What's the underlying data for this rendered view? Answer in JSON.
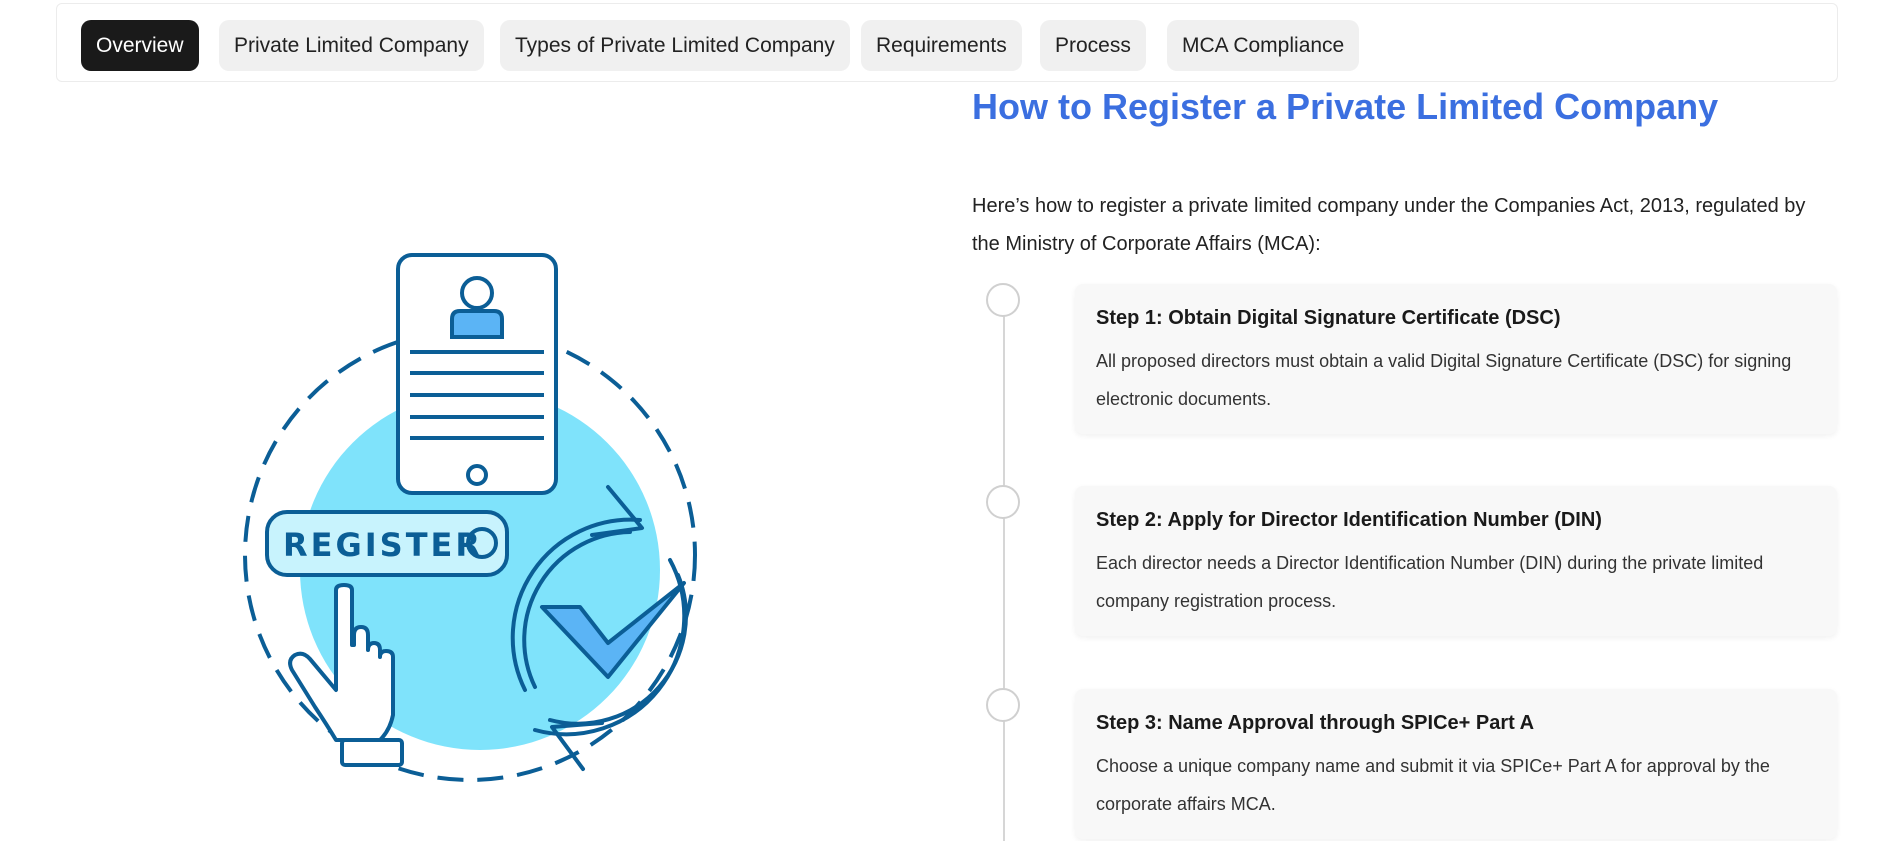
{
  "tabs": [
    {
      "label": "Overview",
      "active": true
    },
    {
      "label": "Private Limited Company",
      "active": false
    },
    {
      "label": "Types of Private Limited Company",
      "active": false
    },
    {
      "label": "Requirements",
      "active": false
    },
    {
      "label": "Process",
      "active": false
    },
    {
      "label": "MCA Compliance",
      "active": false
    }
  ],
  "illustration": {
    "button_text": "REGISTER"
  },
  "main": {
    "title": "How to Register a Private Limited Company",
    "intro": "Here’s how to register a private limited company under the Companies Act, 2013, regulated by the Ministry of Corporate Affairs (MCA):",
    "steps": [
      {
        "title": "Step 1: Obtain Digital Signature Certificate (DSC)",
        "text": "All proposed directors must obtain a valid Digital Signature Certificate (DSC) for signing electronic documents."
      },
      {
        "title": "Step 2: Apply for Director Identification Number (DIN)",
        "text": "Each director needs a Director Identification Number (DIN) during the private limited company registration process."
      },
      {
        "title": "Step 3: Name Approval through SPICe+ Part A",
        "text": "Choose a unique company name and submit it via SPICe+ Part A for approval by the corporate affairs MCA."
      }
    ]
  },
  "colors": {
    "accent": "#3b6fe0",
    "active_tab": "#1a1a1a",
    "illustration_blue": "#0b5e96",
    "illustration_cyan": "#7fe3fb"
  }
}
